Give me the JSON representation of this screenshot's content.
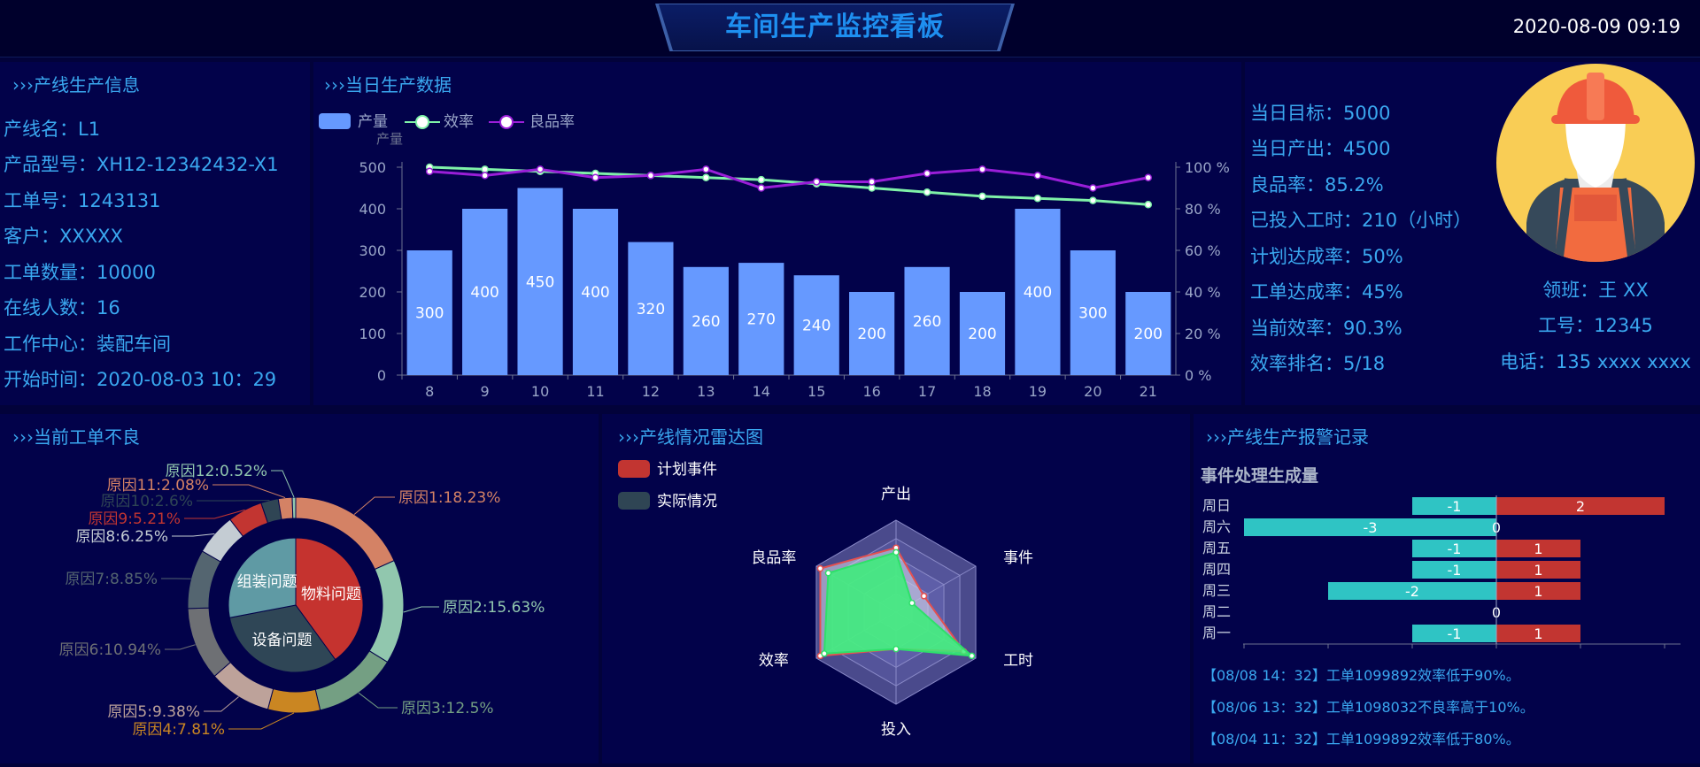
{
  "header": {
    "title": "车间生产监控看板",
    "clock": "2020-08-09 09:19"
  },
  "line_info": {
    "title": "›››产线生产信息",
    "lines": [
      "产线名：L1",
      "产品型号：XH12-12342432-X1",
      "工单号：1243131",
      "客户：XXXXX",
      "工单数量：10000",
      "在线人数：16",
      "工作中心：装配车间",
      "开始时间：2020-08-03 10：29"
    ]
  },
  "daily": {
    "title": "›››当日生产数据",
    "legend": [
      "产量",
      "效率",
      "良品率"
    ],
    "y_left_label": "产量",
    "y_left_ticks": [
      "0",
      "100",
      "200",
      "300",
      "400",
      "500"
    ],
    "y_right_ticks": [
      "0 %",
      "20 %",
      "40 %",
      "60 %",
      "80 %",
      "100 %"
    ]
  },
  "chart_data": [
    {
      "type": "bar",
      "title": "",
      "categories": [
        "8",
        "9",
        "10",
        "11",
        "12",
        "13",
        "14",
        "15",
        "16",
        "17",
        "18",
        "19",
        "20",
        "21"
      ],
      "series": [
        {
          "name": "产量",
          "type": "bar",
          "values": [
            300,
            400,
            450,
            400,
            320,
            260,
            270,
            240,
            200,
            260,
            200,
            400,
            300,
            200
          ]
        },
        {
          "name": "效率",
          "type": "line",
          "values": [
            100,
            99,
            98,
            97,
            96,
            95,
            94,
            92,
            90,
            88,
            86,
            85,
            84,
            82
          ]
        },
        {
          "name": "良品率",
          "type": "line",
          "values": [
            98,
            96,
            99,
            95,
            96,
            99,
            90,
            93,
            93,
            97,
            99,
            96,
            90,
            95
          ]
        }
      ],
      "ylabel": "产量",
      "ylim": [
        0,
        500
      ],
      "y2lim": [
        0,
        100
      ],
      "colors": {
        "bar": "#6699ff",
        "efficiency": "#7ff2a8",
        "yield": "#9a1ed8"
      },
      "label_color": "#ffffff"
    },
    {
      "type": "pie",
      "title": "",
      "inner": [
        {
          "label": "物料问题",
          "value": 40,
          "color": "#c5332f"
        },
        {
          "label": "设备问题",
          "value": 32,
          "color": "#2f4656"
        },
        {
          "label": "组装问题",
          "value": 28,
          "color": "#5f9aa4"
        }
      ],
      "outer": [
        {
          "label": "原因1:18.23%",
          "value": 18.23,
          "color": "#d48265"
        },
        {
          "label": "原因2:15.63%",
          "value": 15.63,
          "color": "#91c7ae"
        },
        {
          "label": "原因3:12.5%",
          "value": 12.5,
          "color": "#749f83"
        },
        {
          "label": "原因4:7.81%",
          "value": 7.81,
          "color": "#ca8622"
        },
        {
          "label": "原因5:9.38%",
          "value": 9.38,
          "color": "#bda29a"
        },
        {
          "label": "原因6:10.94%",
          "value": 10.94,
          "color": "#6e7074"
        },
        {
          "label": "原因7:8.85%",
          "value": 8.85,
          "color": "#546570"
        },
        {
          "label": "原因8:6.25%",
          "value": 6.25,
          "color": "#c4ccd3"
        },
        {
          "label": "原因9:5.21%",
          "value": 5.21,
          "color": "#c23531"
        },
        {
          "label": "原因10:2.6%",
          "value": 2.6,
          "color": "#2f4554"
        },
        {
          "label": "原因11:2.08%",
          "value": 2.08,
          "color": "#d48265"
        },
        {
          "label": "原因12:0.52%",
          "value": 0.52,
          "color": "#91c7ae"
        }
      ]
    },
    {
      "type": "radar",
      "title": "",
      "indicators": [
        "产出",
        "事件",
        "工时",
        "投入",
        "效率",
        "良品率"
      ],
      "series": [
        {
          "name": "计划事件",
          "color": "#c23531",
          "values": [
            0.7,
            0.35,
            0.85,
            0.4,
            0.95,
            0.95
          ]
        },
        {
          "name": "实际情况",
          "color": "#2f4554",
          "values": [
            0.65,
            0.2,
            0.95,
            0.4,
            0.9,
            0.85
          ]
        }
      ]
    },
    {
      "type": "bar",
      "title": "事件处理生成量",
      "orientation": "horizontal",
      "categories": [
        "周一",
        "周二",
        "周三",
        "周四",
        "周五",
        "周六",
        "周日"
      ],
      "series": [
        {
          "name": "",
          "values": [
            -1,
            0,
            -2,
            -1,
            -1,
            -3,
            -1
          ],
          "color": "#2fc4c4"
        },
        {
          "name": "",
          "values": [
            1,
            0,
            1,
            1,
            1,
            0,
            2
          ],
          "color": "#c23531"
        }
      ],
      "xlim": [
        -3,
        2
      ]
    }
  ],
  "defects": {
    "title": "›››当前工单不良"
  },
  "radar": {
    "title": "›››产线情况雷达图",
    "legend": [
      "计划事件",
      "实际情况"
    ]
  },
  "kpi": {
    "lines": [
      "当日目标：5000",
      "当日产出：4500",
      "良品率：85.2%",
      "已投入工时：210（小时）",
      "计划达成率：50%",
      "工单达成率：45%",
      "当前效率：90.3%",
      "效率排名：5/18"
    ]
  },
  "person": {
    "leader": "领班：王 XX",
    "id": "工号：12345",
    "phone": "电话：135 xxxx xxxx"
  },
  "alarm": {
    "title": "›››产线生产报警记录",
    "chart_title": "事件处理生成量",
    "logs": [
      "【08/08 14：32】工单1099892效率低于90%。",
      "【08/06 13：32】工单1098032不良率高于10%。",
      "【08/04 11：32】工单1099892效率低于80%。"
    ]
  }
}
